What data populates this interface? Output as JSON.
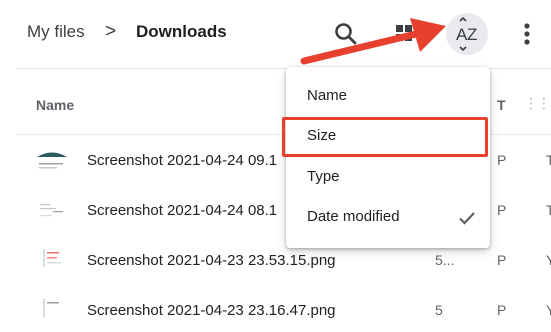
{
  "header": {
    "breadcrumb": [
      "My files",
      "Downloads"
    ],
    "separator": ">",
    "actions": [
      {
        "name": "search",
        "icon": "search-icon"
      },
      {
        "name": "view",
        "icon": "grid-view-icon"
      },
      {
        "name": "sort",
        "icon": "sort-az-icon",
        "label": "AZ"
      },
      {
        "name": "more",
        "icon": "more-vert-icon"
      }
    ]
  },
  "columns": {
    "name": "Name",
    "type": "T",
    "handle": "⋮⋮"
  },
  "files": [
    {
      "name": "Screenshot 2021-04-24 09.1",
      "size": "",
      "type": "P",
      "date": "T"
    },
    {
      "name": "Screenshot 2021-04-24 08.1",
      "size": "",
      "type": "P",
      "date": "T"
    },
    {
      "name": "Screenshot 2021-04-23 23.53.15.png",
      "size": "5...",
      "type": "P",
      "date": "Y"
    },
    {
      "name": "Screenshot 2021-04-23 23.16.47.png",
      "size": "5",
      "type": "P",
      "date": "Y"
    }
  ],
  "sort_menu": {
    "items": [
      {
        "label": "Name",
        "checked": false
      },
      {
        "label": "Size",
        "checked": false,
        "highlighted": true
      },
      {
        "label": "Type",
        "checked": false
      },
      {
        "label": "Date modified",
        "checked": true
      }
    ]
  },
  "colors": {
    "annotation": "#e8402f",
    "sort_button_bg": "#e8eaed"
  }
}
